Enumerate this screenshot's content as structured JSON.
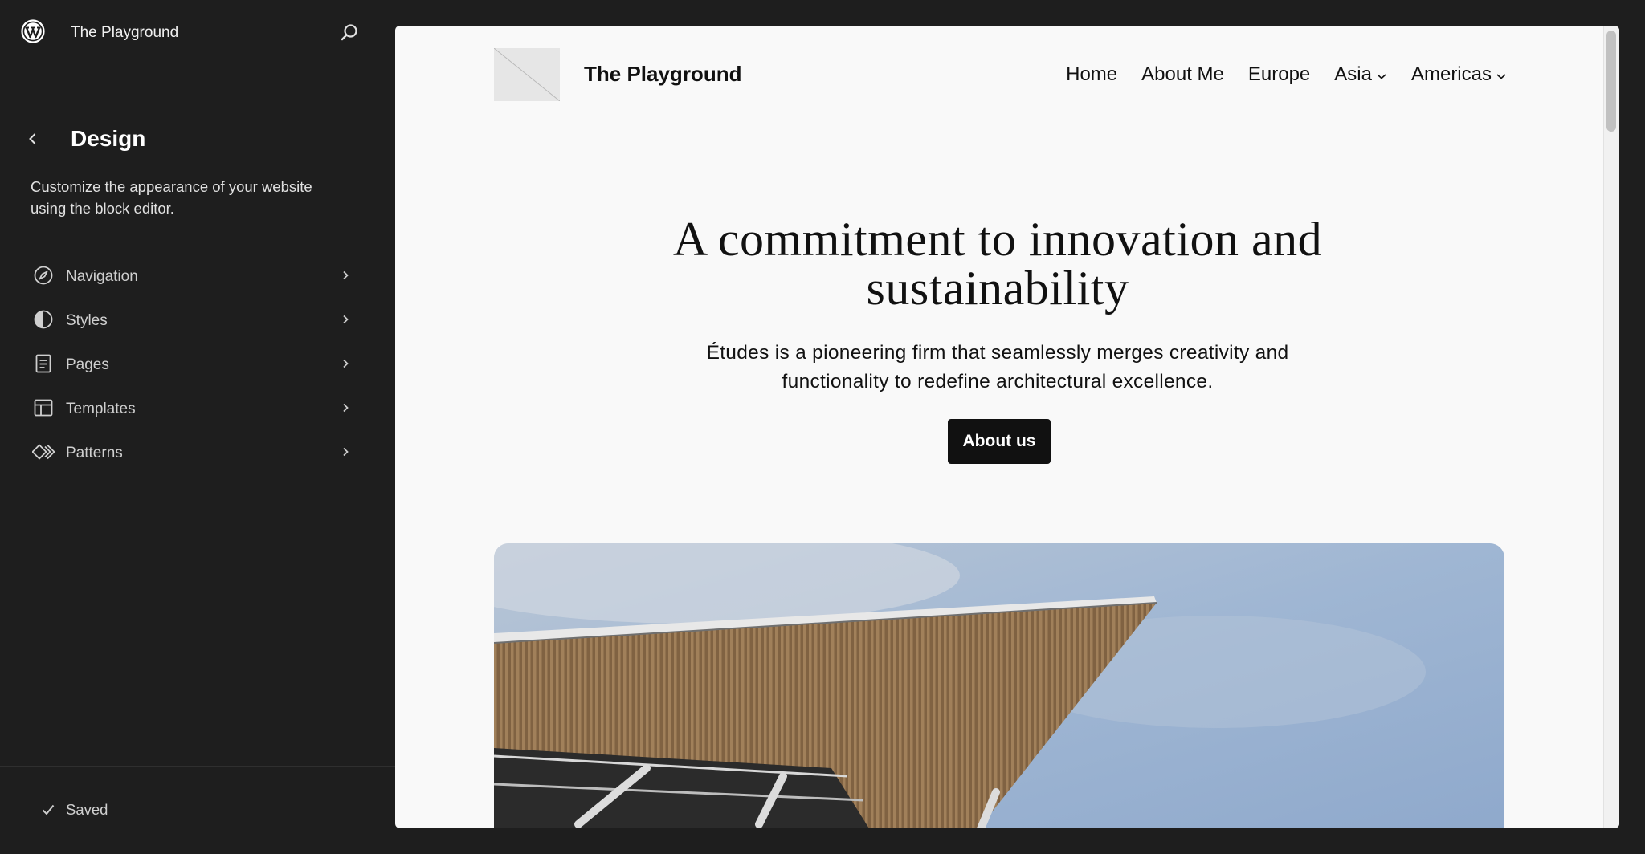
{
  "sidebar": {
    "site_name": "The Playground",
    "title": "Design",
    "description": "Customize the appearance of your website using the block editor.",
    "items": [
      {
        "label": "Navigation",
        "icon": "navigation-icon"
      },
      {
        "label": "Styles",
        "icon": "styles-icon"
      },
      {
        "label": "Pages",
        "icon": "pages-icon"
      },
      {
        "label": "Templates",
        "icon": "templates-icon"
      },
      {
        "label": "Patterns",
        "icon": "patterns-icon"
      }
    ],
    "status": "Saved"
  },
  "preview": {
    "site_title": "The Playground",
    "nav": [
      "Home",
      "About Me",
      "Europe",
      "Asia",
      "Americas"
    ],
    "hero_title": "A commitment to innovation and sustainability",
    "hero_subtitle": "Études is a pioneering firm that seamlessly merges creativity and functionality to redefine architectural excellence.",
    "hero_button": "About us"
  },
  "colors": {
    "sidebar_bg": "#1e1e1e",
    "canvas_bg": "#f9f9f9",
    "button_bg": "#111111"
  }
}
